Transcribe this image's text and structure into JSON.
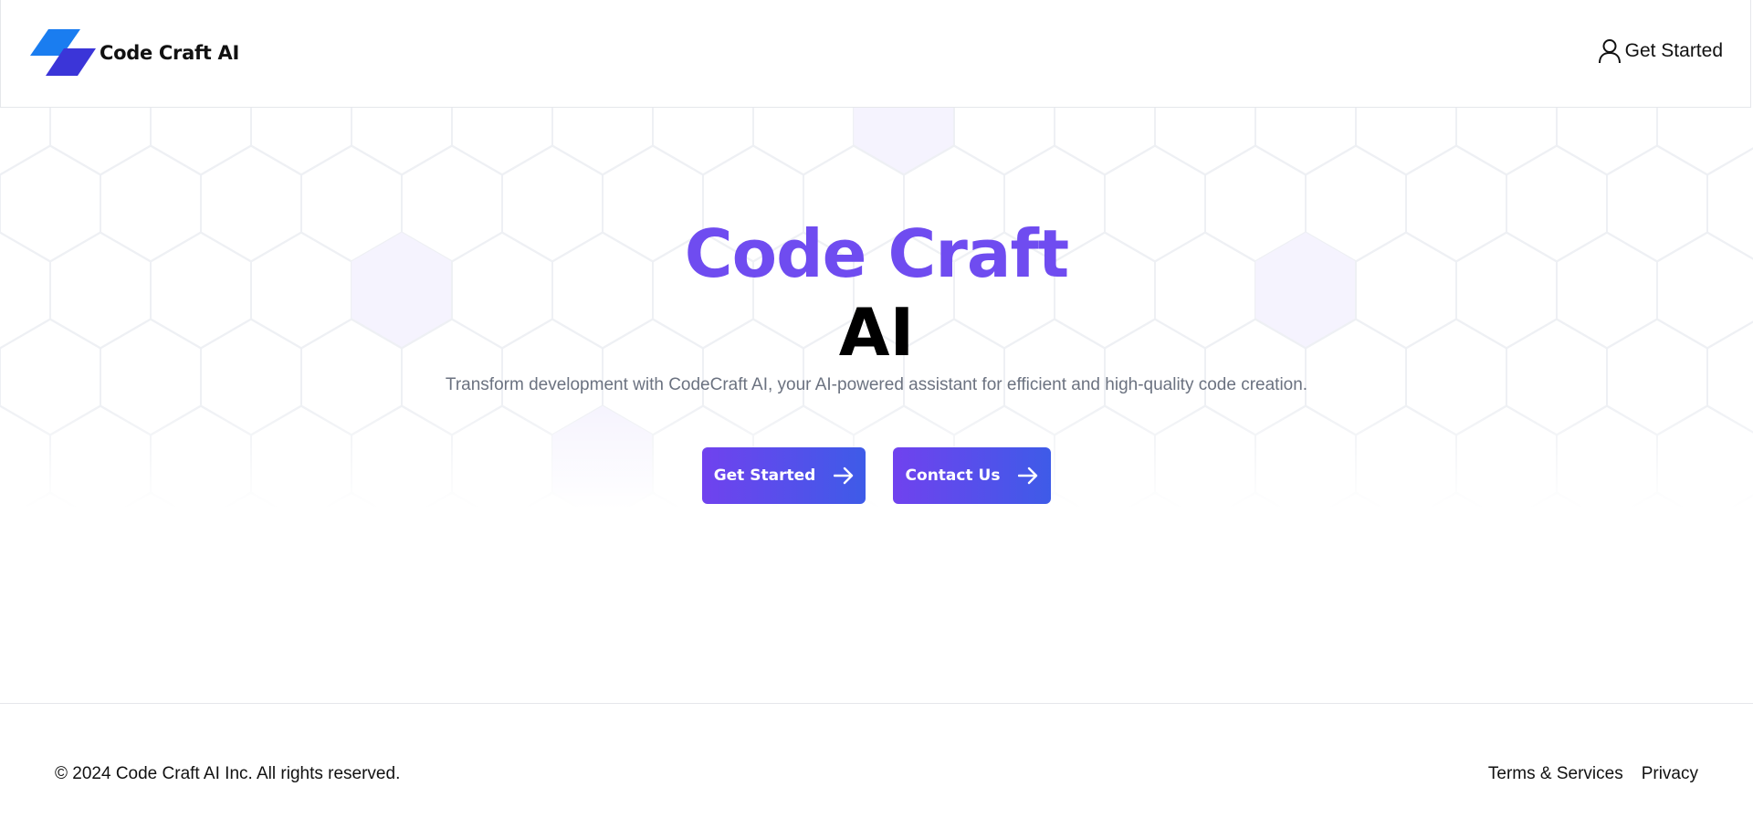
{
  "header": {
    "brand_name": "Code Craft AI",
    "logo_icon": "parallelogram-logo-icon",
    "cta_label": "Get Started",
    "cta_icon": "user-icon"
  },
  "hero": {
    "title_line1": "Code Craft",
    "title_line2": "AI",
    "subtitle": "Transform development with CodeCraft AI, your AI-powered assistant for efficient and high-quality code creation.",
    "primary_button": "Get Started",
    "secondary_button": "Contact Us",
    "button_icon": "arrow-right-icon",
    "accent_color": "#6f4cf0",
    "button_gradient": [
      "#7042ee",
      "#3e5be8"
    ]
  },
  "footer": {
    "copyright": "© 2024 Code Craft AI Inc. All rights reserved.",
    "links": [
      "Terms & Services",
      "Privacy"
    ]
  }
}
